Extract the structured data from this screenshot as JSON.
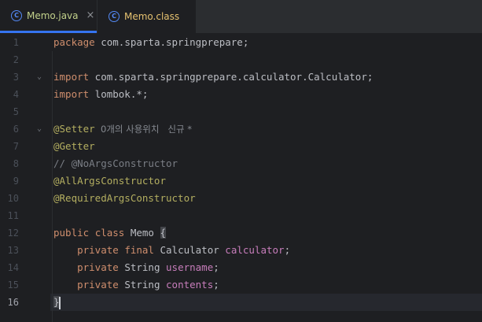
{
  "tabs": [
    {
      "label": "Memo.java",
      "icon": "class-c-icon",
      "close": "×",
      "active": true
    },
    {
      "label": "Memo.class",
      "icon": "class-c-icon",
      "active": false
    }
  ],
  "line_numbers": [
    "1",
    "2",
    "3",
    "4",
    "5",
    "6",
    "7",
    "8",
    "9",
    "10",
    "11",
    "12",
    "13",
    "14",
    "15",
    "16"
  ],
  "fold_glyph": "⌄",
  "code": {
    "l1": {
      "kw": "package",
      "rest": " com.sparta.springprepare;"
    },
    "l3": {
      "kw": "import",
      "rest": " com.sparta.springprepare.calculator.Calculator;"
    },
    "l4": {
      "kw": "import",
      "rest": " lombok.*;"
    },
    "l6": {
      "ann": "@Setter",
      "hint": "  0개의 사용위치   신규 *"
    },
    "l7": {
      "ann": "@Getter"
    },
    "l8": {
      "cmt": "// @NoArgsConstructor"
    },
    "l9": {
      "ann": "@AllArgsConstructor"
    },
    "l10": {
      "ann": "@RequiredArgsConstructor"
    },
    "l12": {
      "kw1": "public",
      "kw2": "class",
      "name": "Memo",
      "brace": "{"
    },
    "l13": {
      "kw1": "private",
      "kw2": "final",
      "type": "Calculator",
      "field": "calculator",
      "end": ";"
    },
    "l14": {
      "kw1": "private",
      "type": "String",
      "field": "username",
      "end": ";"
    },
    "l15": {
      "kw1": "private",
      "type": "String",
      "field": "contents",
      "end": ";"
    },
    "l16": {
      "brace": "}"
    }
  },
  "colors": {
    "keyword": "#cf8e6d",
    "annotation": "#b3ae60",
    "field": "#c77dbb",
    "comment": "#7a7e85",
    "accent": "#3574f0"
  }
}
